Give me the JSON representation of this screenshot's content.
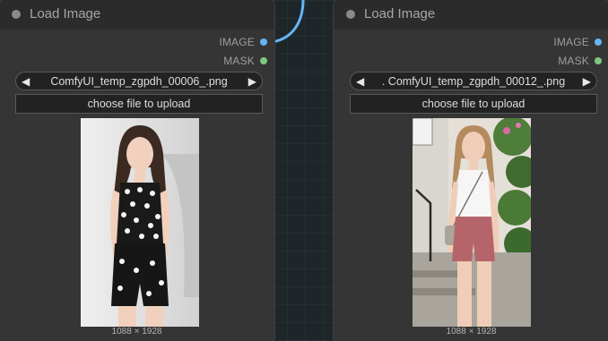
{
  "nodes": [
    {
      "title": "Load Image",
      "outputs": [
        {
          "label": "IMAGE",
          "color": "#64b5f6"
        },
        {
          "label": "MASK",
          "color": "#81c784"
        }
      ],
      "file": "ComfyUI_temp_zgpdh_00006_.png",
      "prev_arrow": "◀",
      "next_arrow": "▶",
      "upload_label": "choose file to upload",
      "preview_dims": "1088 × 1928"
    },
    {
      "title": "Load Image",
      "outputs": [
        {
          "label": "IMAGE",
          "color": "#64b5f6"
        },
        {
          "label": "MASK",
          "color": "#81c784"
        }
      ],
      "file": ". ComfyUI_temp_zgpdh_00012_.png",
      "prev_arrow": "◀",
      "next_arrow": "▶",
      "upload_label": "choose file to upload",
      "preview_dims": "1088 × 1928"
    }
  ],
  "icons": {
    "collapse": "collapse-dot-icon",
    "prev": "triangle-left-icon",
    "next": "triangle-right-icon"
  },
  "colors": {
    "canvas": "#1e2629",
    "node_body": "#353535",
    "node_header": "#2b2b2b",
    "link": "#64b5f6"
  }
}
